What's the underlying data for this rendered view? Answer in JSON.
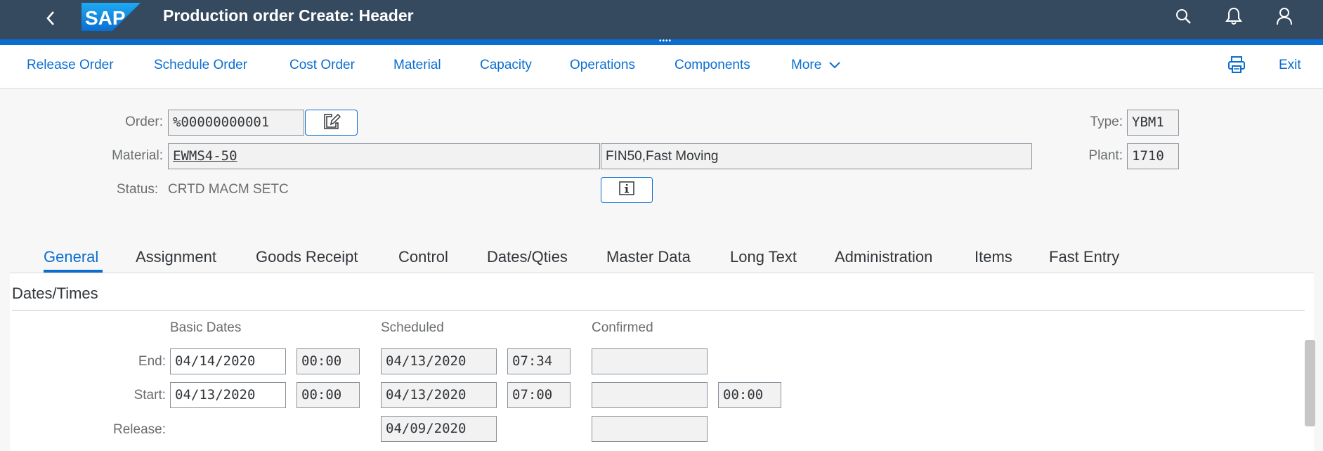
{
  "shell": {
    "title": "Production order Create: Header",
    "logo_text": "SAP",
    "icons": [
      "back-icon",
      "search-icon",
      "bell-icon",
      "user-icon"
    ],
    "colors": {
      "shell_bg": "#354a5f",
      "accent": "#0a6ed1"
    }
  },
  "toolbar": {
    "items": [
      "Release Order",
      "Schedule Order",
      "Cost Order",
      "Material",
      "Capacity",
      "Operations",
      "Components",
      "More"
    ],
    "exit_label": "Exit",
    "icons": [
      "chevron-down-icon",
      "print-icon"
    ]
  },
  "header": {
    "order_label": "Order:",
    "order_value": "%00000000001",
    "material_label": "Material:",
    "material_value": "EWMS4-50",
    "material_desc": "FIN50,Fast Moving",
    "status_label": "Status:",
    "status_value": "CRTD MACM SETC",
    "type_label": "Type:",
    "type_value": "YBM1",
    "plant_label": "Plant:",
    "plant_value": "1710",
    "icons": [
      "edit-icon",
      "info-icon"
    ]
  },
  "tabs": [
    "General",
    "Assignment",
    "Goods Receipt",
    "Control",
    "Dates/Qties",
    "Master Data",
    "Long Text",
    "Administration",
    "Items",
    "Fast Entry"
  ],
  "active_tab": "General",
  "dates": {
    "section_title": "Dates/Times",
    "columns": [
      "Basic Dates",
      "Scheduled",
      "Confirmed"
    ],
    "rows": {
      "end": {
        "label": "End:",
        "basic_date": "04/14/2020",
        "basic_time": "00:00",
        "sched_date": "04/13/2020",
        "sched_time": "07:34",
        "conf_date": ""
      },
      "start": {
        "label": "Start:",
        "basic_date": "04/13/2020",
        "basic_time": "00:00",
        "sched_date": "04/13/2020",
        "sched_time": "07:00",
        "conf_date": "",
        "conf_time": "00:00"
      },
      "release": {
        "label": "Release:",
        "sched_date": "04/09/2020",
        "conf_date": ""
      }
    }
  }
}
